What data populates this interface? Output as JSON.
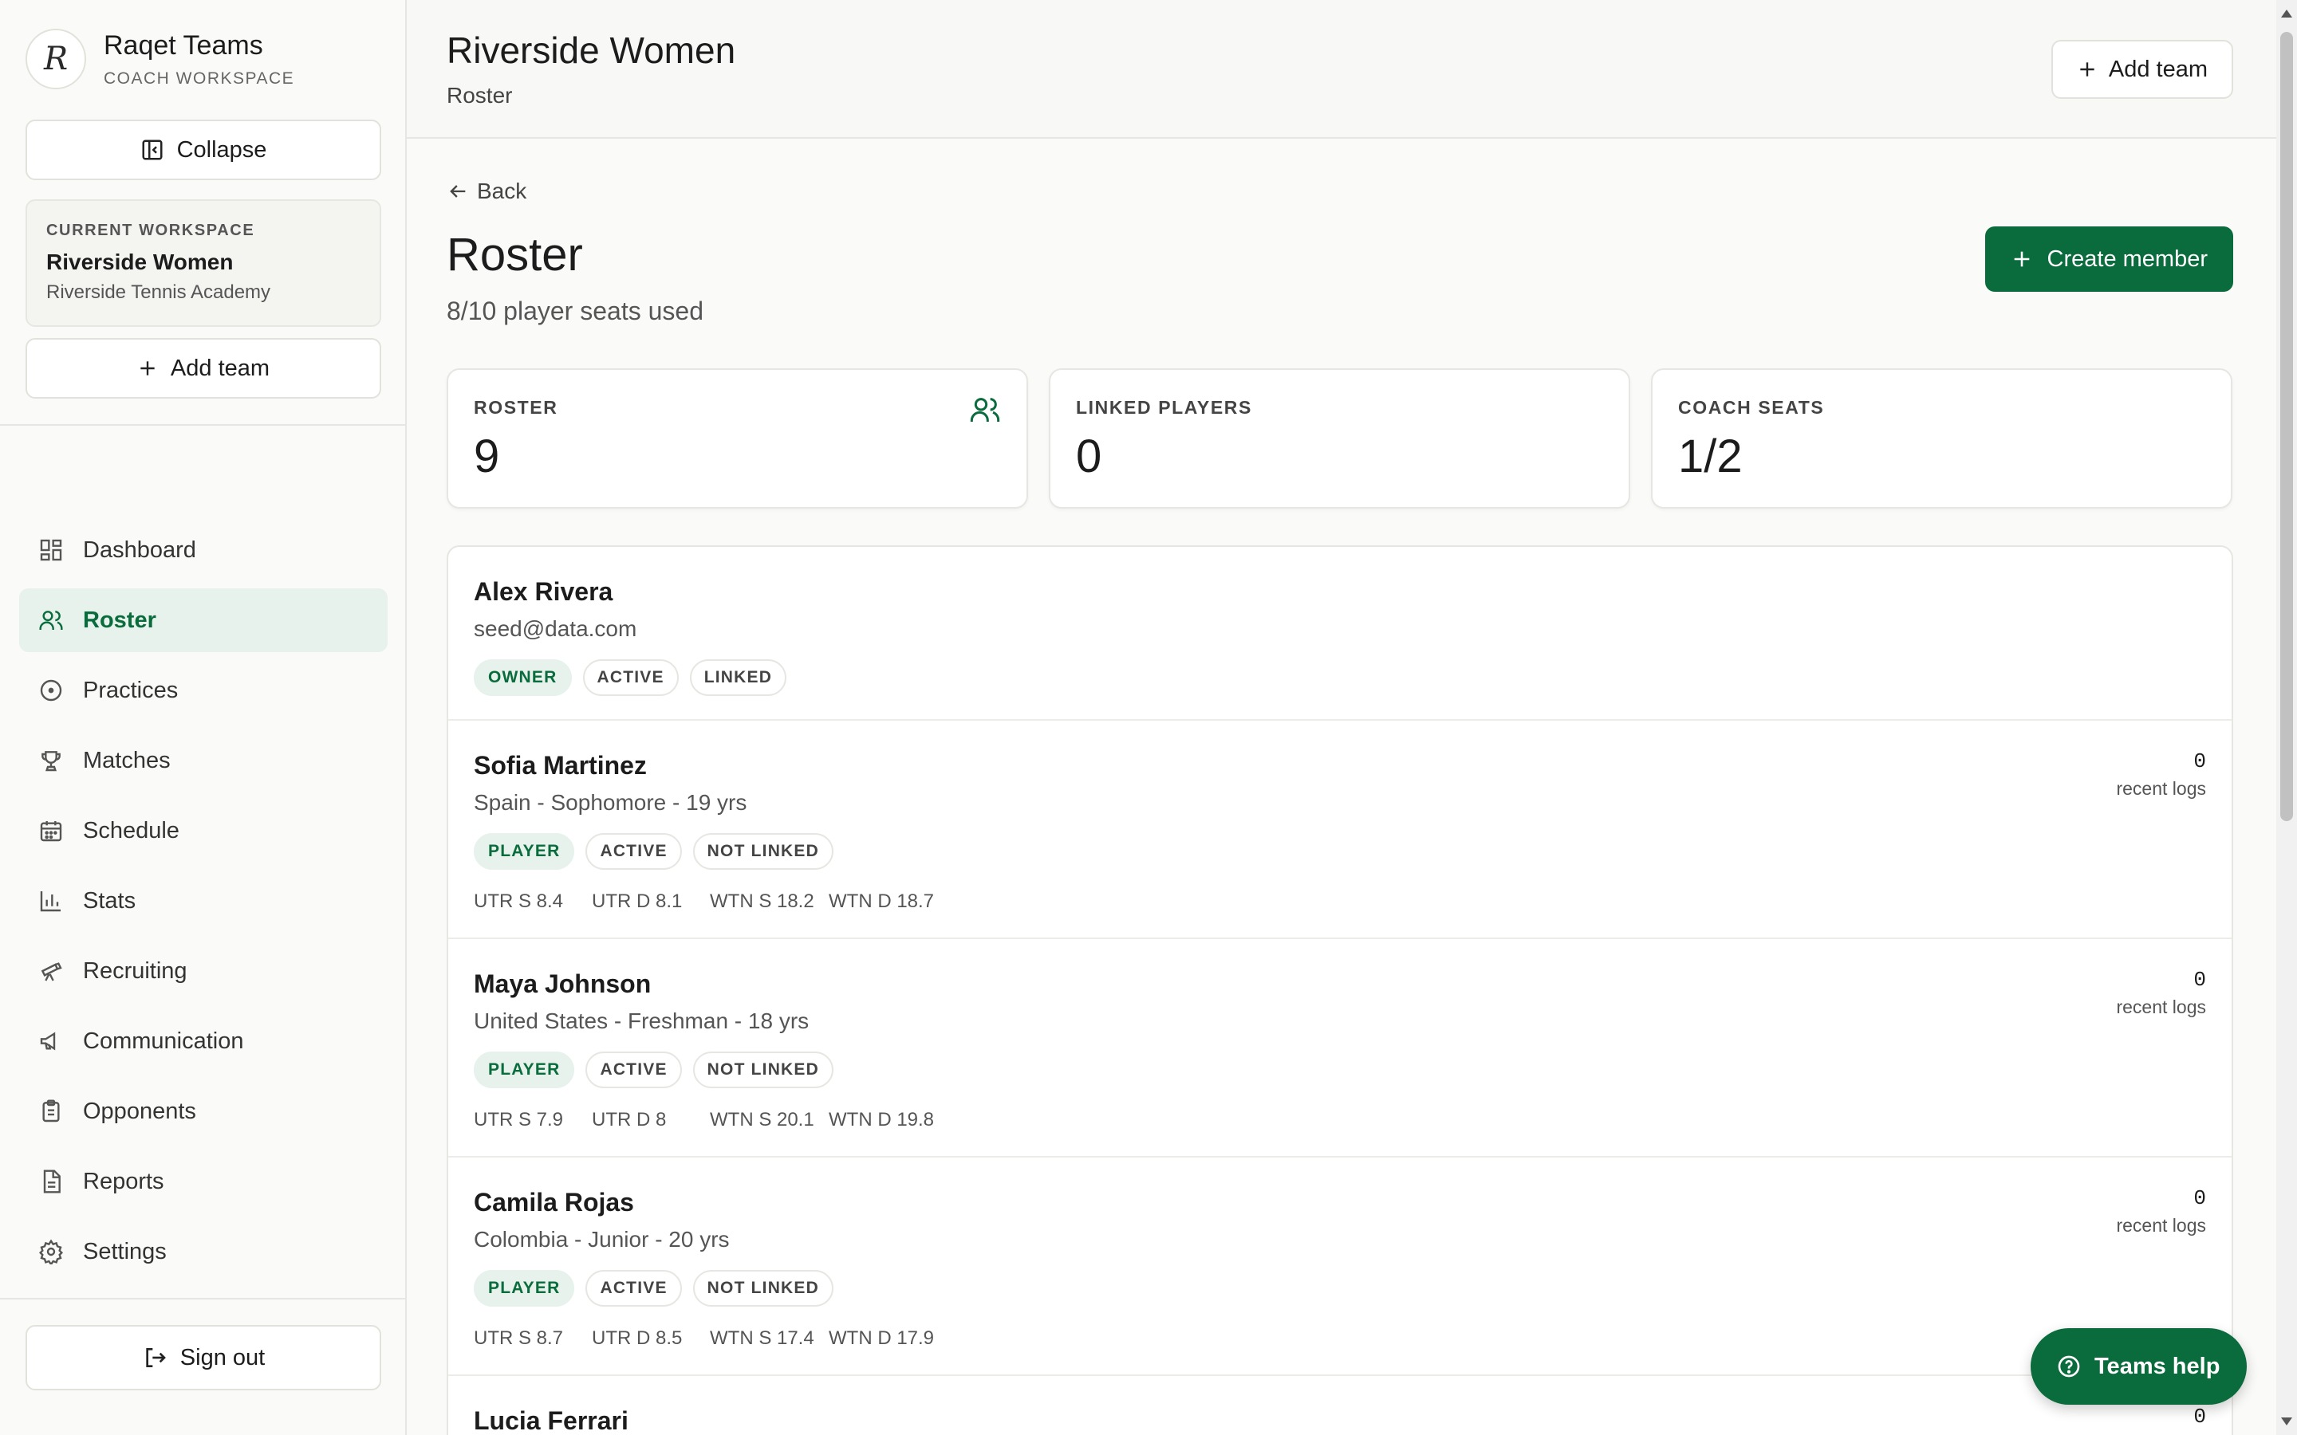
{
  "brand": {
    "name": "Raqet Teams",
    "subtitle": "COACH WORKSPACE",
    "logo_letter": "R"
  },
  "sidebar": {
    "collapse_label": "Collapse",
    "workspace": {
      "label": "CURRENT WORKSPACE",
      "team": "Riverside Women",
      "org": "Riverside Tennis Academy"
    },
    "add_team_label": "Add team",
    "nav": [
      {
        "label": "Dashboard",
        "icon": "dashboard-icon"
      },
      {
        "label": "Roster",
        "icon": "users-icon",
        "active": true
      },
      {
        "label": "Practices",
        "icon": "target-icon"
      },
      {
        "label": "Matches",
        "icon": "trophy-icon"
      },
      {
        "label": "Schedule",
        "icon": "calendar-icon"
      },
      {
        "label": "Stats",
        "icon": "bar-chart-icon"
      },
      {
        "label": "Recruiting",
        "icon": "telescope-icon"
      },
      {
        "label": "Communication",
        "icon": "megaphone-icon"
      },
      {
        "label": "Opponents",
        "icon": "clipboard-icon"
      },
      {
        "label": "Reports",
        "icon": "file-icon"
      },
      {
        "label": "Settings",
        "icon": "gear-icon"
      }
    ],
    "sign_out_label": "Sign out"
  },
  "header": {
    "title": "Riverside Women",
    "subtitle": "Roster",
    "add_team_label": "Add team"
  },
  "page": {
    "back_label": "Back",
    "title": "Roster",
    "seats_text": "8/10 player seats used",
    "create_label": "Create member"
  },
  "stats": [
    {
      "label": "ROSTER",
      "value": "9"
    },
    {
      "label": "LINKED PLAYERS",
      "value": "0"
    },
    {
      "label": "COACH SEATS",
      "value": "1/2"
    }
  ],
  "members": [
    {
      "name": "Alex Rivera",
      "detail": "seed@data.com",
      "role": "OWNER",
      "status": "ACTIVE",
      "link": "LINKED"
    },
    {
      "name": "Sofia Martinez",
      "detail": "Spain - Sophomore - 19 yrs",
      "role": "PLAYER",
      "status": "ACTIVE",
      "link": "NOT LINKED",
      "ratings": [
        "UTR S 8.4",
        "UTR D 8.1",
        "WTN S 18.2",
        "WTN D 18.7"
      ],
      "logs": "0",
      "logs_label": "recent logs"
    },
    {
      "name": "Maya Johnson",
      "detail": "United States - Freshman - 18 yrs",
      "role": "PLAYER",
      "status": "ACTIVE",
      "link": "NOT LINKED",
      "ratings": [
        "UTR S 7.9",
        "UTR D 8",
        "WTN S 20.1",
        "WTN D 19.8"
      ],
      "logs": "0",
      "logs_label": "recent logs"
    },
    {
      "name": "Camila Rojas",
      "detail": "Colombia - Junior - 20 yrs",
      "role": "PLAYER",
      "status": "ACTIVE",
      "link": "NOT LINKED",
      "ratings": [
        "UTR S 8.7",
        "UTR D 8.5",
        "WTN S 17.4",
        "WTN D 17.9"
      ],
      "logs": "0",
      "logs_label": "recent logs"
    },
    {
      "name": "Lucia Ferrari",
      "logs": "0"
    }
  ],
  "help_label": "Teams help",
  "colors": {
    "accent": "#0a6b3c",
    "accent_soft": "#e6f2eb"
  }
}
